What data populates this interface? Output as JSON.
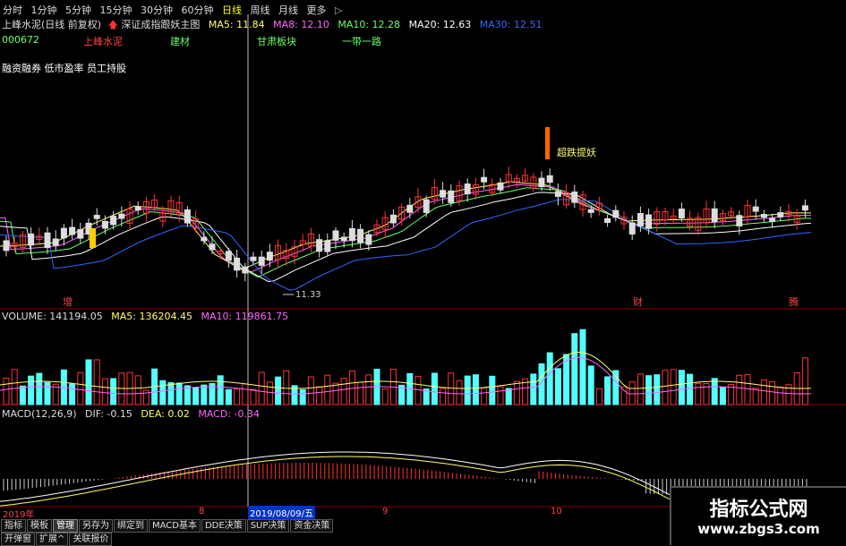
{
  "timeframes": [
    "分时",
    "1分钟",
    "5分钟",
    "15分钟",
    "30分钟",
    "60分钟",
    "日线",
    "周线",
    "月线",
    "更多"
  ],
  "active_timeframe": "日线",
  "more_arrow": "▷",
  "header": {
    "stock_title": "上峰水泥(日线 前复权)",
    "indicator_name": "深证成指跟妖主图",
    "ma": [
      {
        "label": "MA5: 11.84",
        "color": "#ffff66"
      },
      {
        "label": "MA8: 12.10",
        "color": "#ff66ff"
      },
      {
        "label": "MA10: 12.28",
        "color": "#66ff66"
      },
      {
        "label": "MA20: 12.63",
        "color": "#ffffff"
      },
      {
        "label": "MA30: 12.51",
        "color": "#3366ff"
      }
    ]
  },
  "info": {
    "code": "000672",
    "name": "上峰水泥",
    "sector1": "建材",
    "sector2": "甘肃板块",
    "sector3": "一带一路",
    "concepts": "融资融券 低市盈率 员工持股"
  },
  "annotations": {
    "pullback": "超跌提妖",
    "price_low": "11.33",
    "marker_left": "增",
    "marker_mid": "财",
    "marker_right": "腾"
  },
  "volume": {
    "label": "VOLUME: 141194.05",
    "ma5": "MA5: 136204.45",
    "ma10": "MA10: 119861.75"
  },
  "macd": {
    "label": "MACD(12,26,9)",
    "dif": "DIF: -0.15",
    "dea": "DEA: 0.02",
    "macd": "MACD: -0.34"
  },
  "axis": {
    "year": "2019年",
    "m8": "8",
    "cursor_date": "2019/08/09/五",
    "m9": "9",
    "m10": "10"
  },
  "bottom_buttons": [
    "指标",
    "模板",
    "管理",
    "另存为",
    "绑定到",
    "MACD基本",
    "DDE决策",
    "SUP决策",
    "资金决策"
  ],
  "active_bottom": "管理",
  "bottom_row2": [
    "开弹窗",
    "扩展^",
    "关联报价"
  ],
  "watermark": {
    "title": "指标公式网",
    "url": "www.zbgs3.com"
  },
  "colors": {
    "up": "#ff3333",
    "down": "#54ffff",
    "grid": "#8b0000",
    "label_red": "#ff4444"
  }
}
